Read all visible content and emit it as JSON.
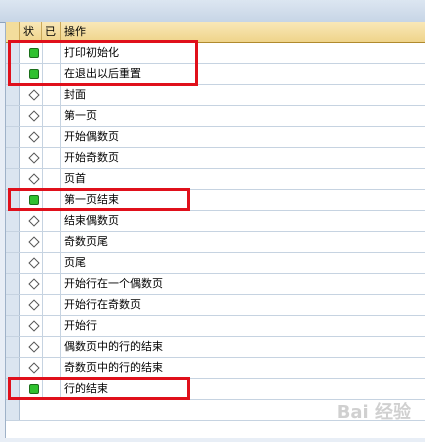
{
  "header": {
    "status": "状",
    "done": "已",
    "operation": "操作"
  },
  "rows": [
    {
      "status": "green",
      "label": "打印初始化"
    },
    {
      "status": "green",
      "label": "在退出以后重置"
    },
    {
      "status": "diamond",
      "label": "封面"
    },
    {
      "status": "diamond",
      "label": "第一页"
    },
    {
      "status": "diamond",
      "label": "开始偶数页"
    },
    {
      "status": "diamond",
      "label": "开始奇数页"
    },
    {
      "status": "diamond",
      "label": "页首"
    },
    {
      "status": "green",
      "label": "第一页结束"
    },
    {
      "status": "diamond",
      "label": "结束偶数页"
    },
    {
      "status": "diamond",
      "label": "奇数页尾"
    },
    {
      "status": "diamond",
      "label": "页尾"
    },
    {
      "status": "diamond",
      "label": "开始行在一个偶数页"
    },
    {
      "status": "diamond",
      "label": "开始行在奇数页"
    },
    {
      "status": "diamond",
      "label": "开始行"
    },
    {
      "status": "diamond",
      "label": "偶数页中的行的结束"
    },
    {
      "status": "diamond",
      "label": "奇数页中的行的结束"
    },
    {
      "status": "green",
      "label": "行的结束"
    }
  ],
  "watermark": "Bai 经验",
  "colors": {
    "status_ok": "#2fc12f",
    "highlight": "#e0101b",
    "header_bg": "#efd48a"
  }
}
